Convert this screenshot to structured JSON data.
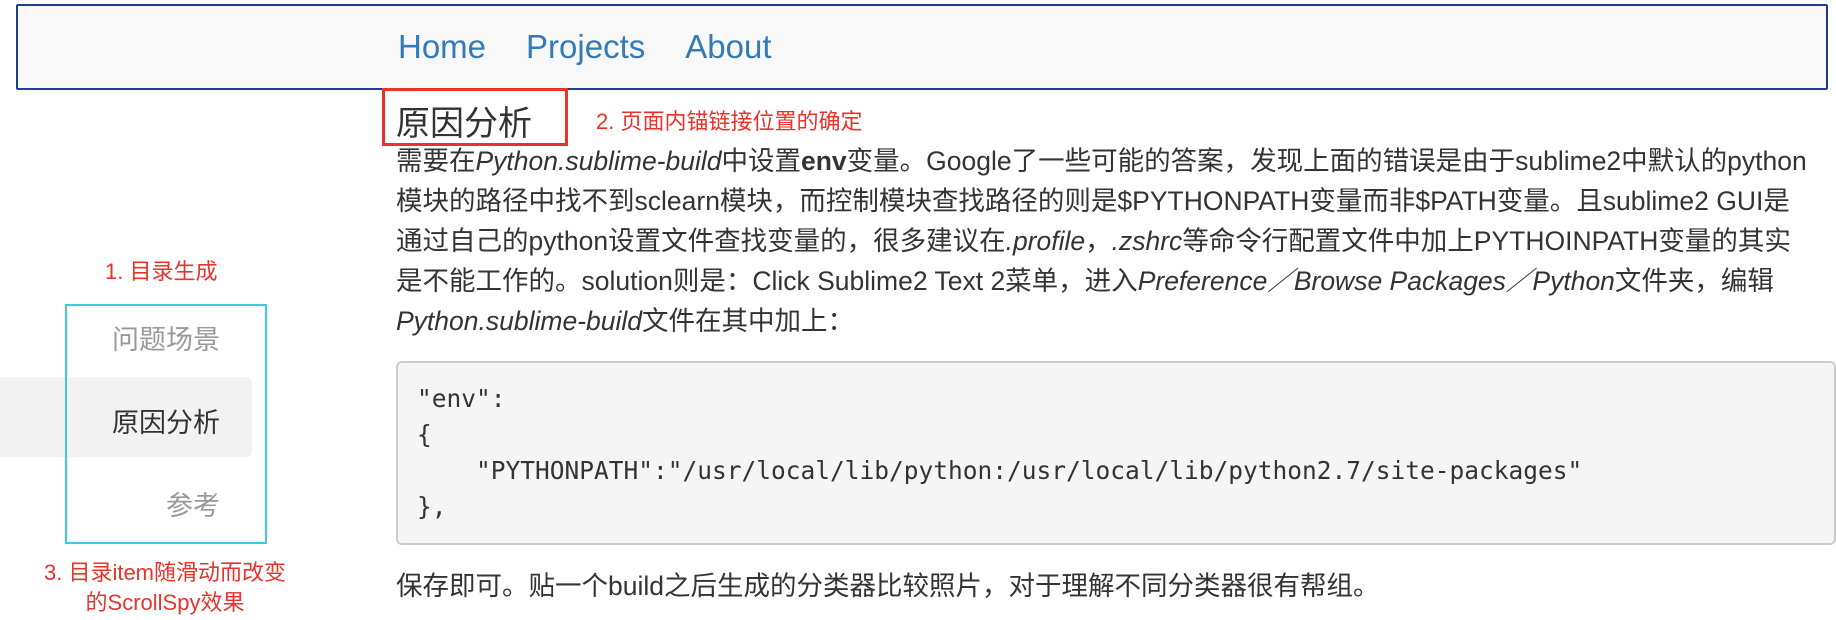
{
  "nav": {
    "links": [
      "Home",
      "Projects",
      "About"
    ]
  },
  "sidebar": {
    "note_top": "1. 目录生成",
    "items": [
      {
        "label": "问题场景",
        "active": false
      },
      {
        "label": "原因分析",
        "active": true
      },
      {
        "label": "参考",
        "active": false
      }
    ],
    "note_bottom_line1": "3. 目录item随滑动而改变",
    "note_bottom_line2": "的ScrollSpy效果"
  },
  "main": {
    "section_title": "原因分析",
    "anchor_note": "2. 页面内锚链接位置的确定",
    "paragraph": {
      "p1": "需要在",
      "p2": "Python.sublime-build",
      "p3": "中设置",
      "p4": "env",
      "p5": "变量。Google了一些可能的答案，发现上面的错误是由于sublime2中默认的python模块的路径中找不到sclearn模块，而控制模块查找路径的则是$PYTHONPATH变量而非$PATH变量。且sublime2 GUI是通过自己的python设置文件查找变量的，很多建议在",
      "p6": ".profile",
      "p7": "，",
      "p8": ".zshrc",
      "p9": "等命令行配置文件中加上PYTHOINPATH变量的其实是不能工作的。solution则是：Click Sublime2 Text 2菜单，进入",
      "p10": "Preference／Browse Packages／Python",
      "p11": "文件夹，编辑",
      "p12": "Python.sublime-build",
      "p13": "文件在其中加上："
    },
    "code_lines": [
      "\"env\":",
      "{",
      "    \"PYTHONPATH\":\"/usr/local/lib/python:/usr/local/lib/python2.7/site-packages\"",
      "},"
    ],
    "closing_text": "保存即可。贴一个build之后生成的分类器比较照片，对于理解不同分类器很有帮组。"
  },
  "colors": {
    "link": "#337ab7",
    "annotation_red": "#e8322b",
    "toc_border": "#3fc9e8",
    "navbar_border": "#1b3f93"
  }
}
